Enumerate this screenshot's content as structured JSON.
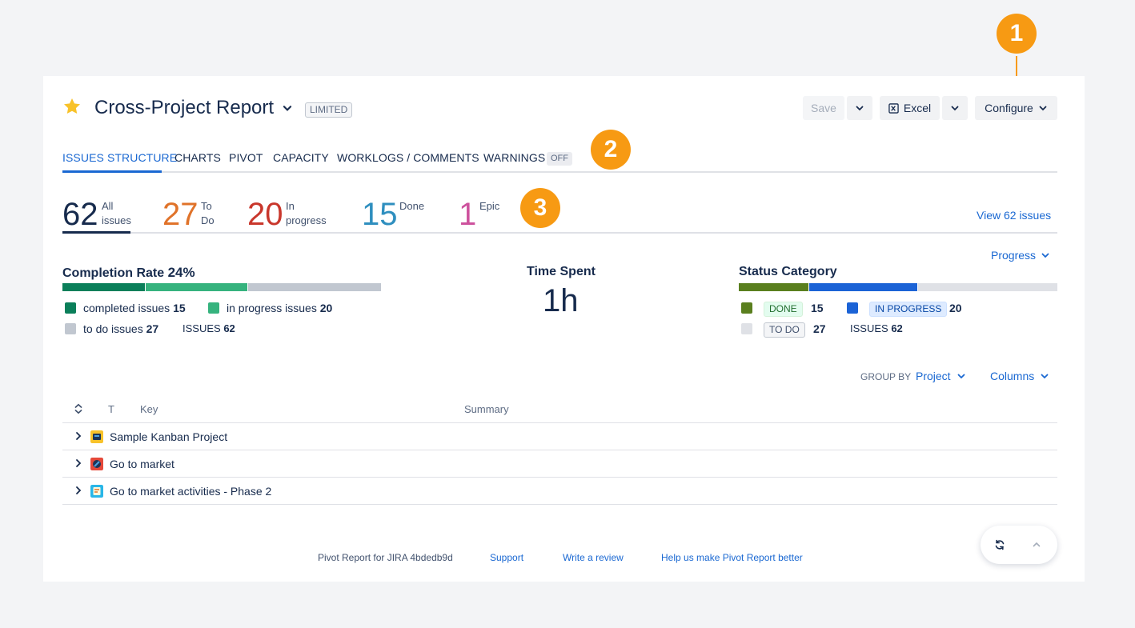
{
  "callouts": [
    "1",
    "2",
    "3"
  ],
  "header": {
    "title": "Cross-Project Report",
    "badge": "LIMITED",
    "save_label": "Save",
    "excel_label": "Excel",
    "configure_label": "Configure"
  },
  "tabs": [
    {
      "label": "ISSUES STRUCTURE",
      "active": true
    },
    {
      "label": "CHARTS"
    },
    {
      "label": "PIVOT"
    },
    {
      "label": "CAPACITY"
    },
    {
      "label": "WORKLOGS / COMMENTS"
    },
    {
      "label": "WARNINGS",
      "badge": "OFF"
    }
  ],
  "counts": [
    {
      "value": "62",
      "label_line1": "All",
      "label_line2": "issues",
      "color": "#172b4d"
    },
    {
      "value": "27",
      "label_line1": "To",
      "label_line2": "Do",
      "color": "#e0732a"
    },
    {
      "value": "20",
      "label_line1": "In",
      "label_line2": "progress",
      "color": "#c9372c"
    },
    {
      "value": "15",
      "label_line1": "Done",
      "label_line2": "",
      "color": "#2f8fbf"
    },
    {
      "value": "1",
      "label_line1": "Epic",
      "label_line2": "",
      "color": "#cd519d"
    }
  ],
  "view_issues_link": "View 62 issues",
  "progress_dropdown": "Progress",
  "completion": {
    "title": "Completion Rate",
    "rate": "24%",
    "segments": {
      "completed": 15,
      "in_progress": 20,
      "to_do": 27
    },
    "colors": {
      "completed": "#0b7f5a",
      "in_progress": "#36b37e",
      "to_do": "#c1c7d0"
    },
    "completed_label": "completed issues",
    "completed_count": "15",
    "in_progress_label": "in progress issues",
    "in_progress_count": "20",
    "to_do_label": "to do issues",
    "to_do_count": "27",
    "issues_label": "ISSUES",
    "issues_count": "62"
  },
  "time_spent": {
    "title": "Time Spent",
    "value": "1h"
  },
  "status_category": {
    "title": "Status Category",
    "done_label": "DONE",
    "done_count": "15",
    "in_progress_label": "IN PROGRESS",
    "in_progress_count": "20",
    "to_do_label": "TO DO",
    "to_do_count": "27",
    "issues_label": "ISSUES",
    "issues_count": "62",
    "colors": {
      "done": "#5a7f1e",
      "in_progress": "#1b63d6",
      "to_do": "#dfe1e6"
    }
  },
  "group_by": {
    "label": "GROUP BY",
    "value": "Project"
  },
  "columns_label": "Columns",
  "table": {
    "headers": {
      "type": "T",
      "key": "Key",
      "summary": "Summary"
    },
    "rows": [
      {
        "name": "Sample Kanban Project",
        "icon": "kanban-project-icon"
      },
      {
        "name": "Go to market",
        "icon": "market-project-icon"
      },
      {
        "name": "Go to market activities - Phase 2",
        "icon": "activities-project-icon"
      }
    ]
  },
  "footer": {
    "version": "Pivot Report for JIRA 4bdedb9d",
    "support": "Support",
    "review": "Write a review",
    "feedback": "Help us make Pivot Report better"
  },
  "accent_color": "#1a68d2",
  "callout_color": "#f79a13"
}
